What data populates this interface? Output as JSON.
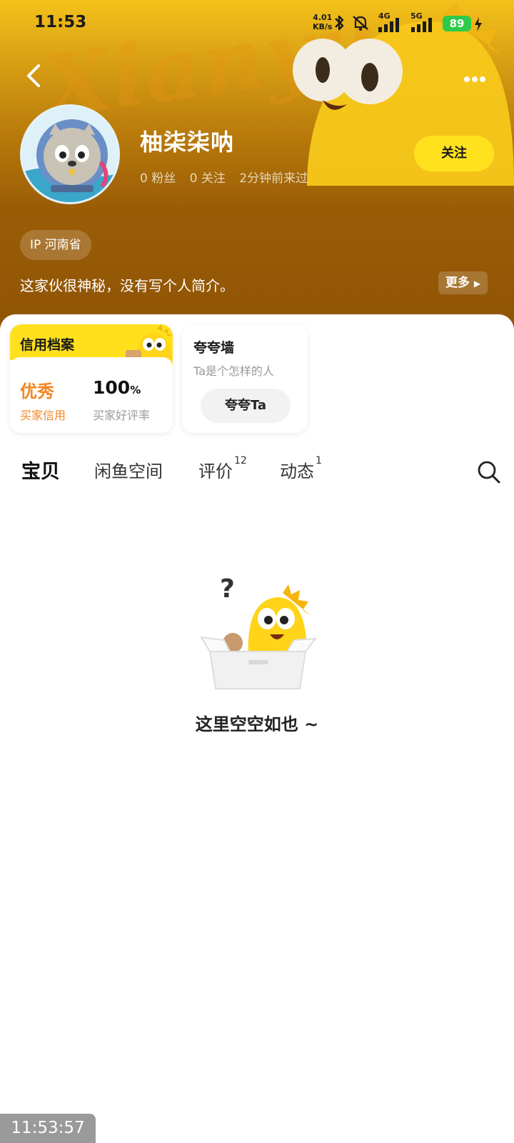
{
  "status_bar": {
    "time": "11:53",
    "speed_value": "4.01",
    "speed_unit": "KB/s",
    "net1": "4G",
    "net2": "5G",
    "battery": "89"
  },
  "header": {
    "watermark": "Xianyu",
    "username": "柚柒柒呐",
    "fans": "0 粉丝",
    "following": "0 关注",
    "last_seen": "2分钟前来过",
    "follow_label": "关注",
    "ip_label": "IP 河南省",
    "bio": "这家伙很神秘，没有写个人简介。",
    "more_label": "更多"
  },
  "credit": {
    "title": "信用档案",
    "rating": "优秀",
    "rating_label": "买家信用",
    "positive_rate": "100",
    "positive_rate_unit": "%",
    "positive_label": "买家好评率"
  },
  "praise": {
    "title": "夸夸墙",
    "subtitle": "Ta是个怎样的人",
    "button": "夸夸Ta"
  },
  "tabs": [
    {
      "label": "宝贝",
      "count": ""
    },
    {
      "label": "闲鱼空间",
      "count": ""
    },
    {
      "label": "评价",
      "count": "12"
    },
    {
      "label": "动态",
      "count": "1"
    }
  ],
  "empty": {
    "text": "这里空空如也 ~"
  },
  "overlay": {
    "time": "11:53:57"
  },
  "colors": {
    "brand_yellow": "#ffe21d",
    "rating_orange": "#f5851f",
    "header_brown": "#8f5405"
  },
  "icons": {
    "back": "chevron-left-icon",
    "more": "more-dots-icon",
    "search": "search-icon"
  }
}
